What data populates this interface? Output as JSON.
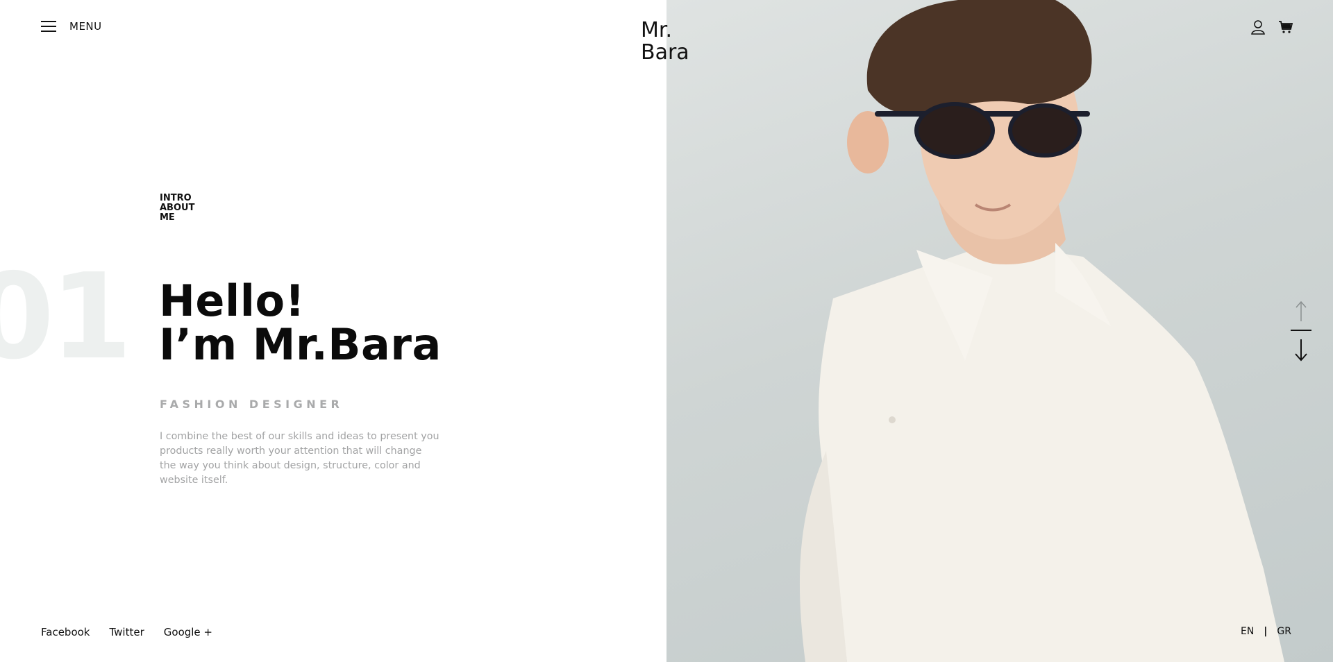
{
  "header": {
    "menu_label": "MENU",
    "logo_line1": "Mr.",
    "logo_line2": "Bara",
    "icons": [
      "user-icon",
      "cart-icon"
    ]
  },
  "hero": {
    "section_tag": [
      "INTRO",
      "ABOUT",
      "ME"
    ],
    "slide_number": "01",
    "headline_line1": "Hello!",
    "headline_line2": "I’m Mr.Bara",
    "role": "FASHION DESIGNER",
    "bio": "I combine the best of our skills and ideas to present you products really worth your attention that will change the way you think about design, structure, color and website itself."
  },
  "footer": {
    "socials": [
      "Facebook",
      "Twitter",
      "Google +"
    ],
    "languages": [
      "EN",
      "GR"
    ],
    "lang_separator": "|"
  },
  "colors": {
    "accent_text": "#111111",
    "muted_text": "#a2a3a4",
    "number_watermark": "#edf0ef",
    "photo_background": "#d3d9d8"
  }
}
